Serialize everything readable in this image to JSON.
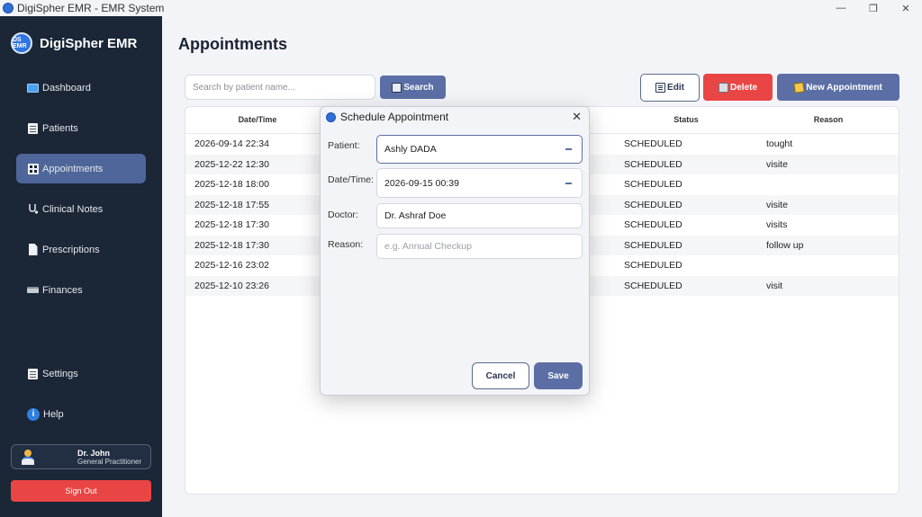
{
  "window": {
    "title": "DigiSpher EMR - EMR System",
    "controls": {
      "minimize": "—",
      "restore": "❐",
      "close": "✕"
    }
  },
  "sidebar": {
    "brand": "DigiSpher EMR",
    "logo_text": "DS EMR",
    "items": [
      {
        "label": "Dashboard",
        "icon": "monitor-icon"
      },
      {
        "label": "Patients",
        "icon": "document-icon"
      },
      {
        "label": "Appointments",
        "icon": "grid-icon",
        "active": true
      },
      {
        "label": "Clinical Notes",
        "icon": "stethoscope-icon"
      },
      {
        "label": "Prescriptions",
        "icon": "page-icon"
      },
      {
        "label": "Finances",
        "icon": "credit-card-icon"
      }
    ],
    "bottom_items": [
      {
        "label": "Settings",
        "icon": "document-icon"
      },
      {
        "label": "Help",
        "icon": "info-icon",
        "glyph": "i"
      }
    ],
    "user": {
      "name": "Dr. John",
      "role": "General Practitioner"
    },
    "signout_label": "Sign Out"
  },
  "main": {
    "title": "Appointments",
    "search": {
      "placeholder": "Search by patient name...",
      "button": "Search"
    },
    "actions": {
      "edit": "Edit",
      "delete": "Delete",
      "new": "New Appointment"
    },
    "table": {
      "columns": [
        "Date/Time",
        "Status",
        "Reason"
      ],
      "rows": [
        {
          "datetime": "2026-09-14 22:34",
          "status": "SCHEDULED",
          "reason": "tought"
        },
        {
          "datetime": "2025-12-22 12:30",
          "status": "SCHEDULED",
          "reason": "visite"
        },
        {
          "datetime": "2025-12-18 18:00",
          "status": "SCHEDULED",
          "reason": ""
        },
        {
          "datetime": "2025-12-18 17:55",
          "status": "SCHEDULED",
          "reason": "visite"
        },
        {
          "datetime": "2025-12-18 17:30",
          "status": "SCHEDULED",
          "reason": "visits"
        },
        {
          "datetime": "2025-12-18 17:30",
          "status": "SCHEDULED",
          "reason": "follow up"
        },
        {
          "datetime": "2025-12-16 23:02",
          "status": "SCHEDULED",
          "reason": ""
        },
        {
          "datetime": "2025-12-10 23:26",
          "status": "SCHEDULED",
          "reason": "visit"
        }
      ]
    }
  },
  "dialog": {
    "title": "Schedule Appointment",
    "close": "✕",
    "fields": {
      "patient": {
        "label": "Patient:",
        "value": "Ashly DADA"
      },
      "datetime": {
        "label": "Date/Time:",
        "value": "2026-09-15 00:39"
      },
      "doctor": {
        "label": "Doctor:",
        "value": "Dr. Ashraf Doe"
      },
      "reason": {
        "label": "Reason:",
        "placeholder": "e.g. Annual Checkup"
      }
    },
    "cancel": "Cancel",
    "save": "Save"
  }
}
